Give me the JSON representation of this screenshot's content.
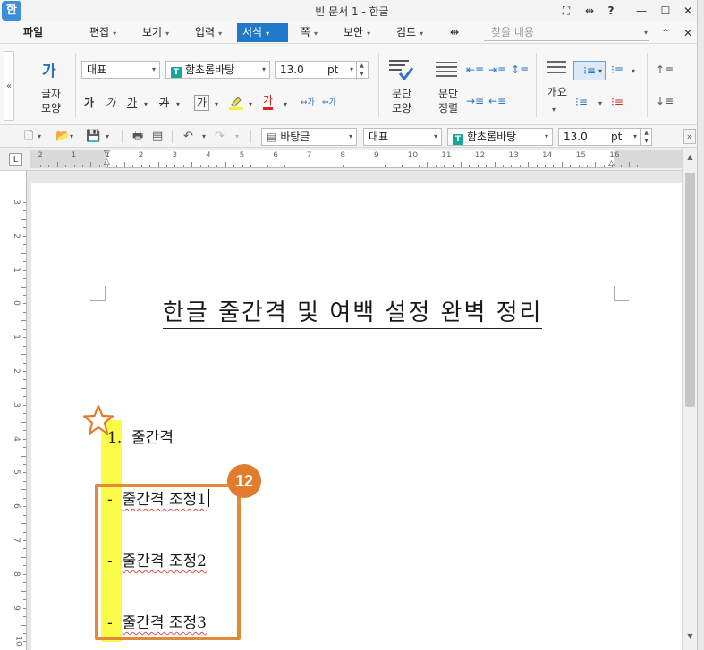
{
  "window": {
    "title": "빈 문서 1 - 한글",
    "app_icon": "한",
    "controls": [
      "⛶",
      "⇹",
      "?",
      "—",
      "☐",
      "✕"
    ]
  },
  "menu": {
    "items": [
      "파일",
      "편집",
      "보기",
      "입력",
      "서식",
      "쪽",
      "보안",
      "검토",
      "⇹"
    ],
    "active_index": 4,
    "search_placeholder": "찾을 내용",
    "collapse": "⌃",
    "close": "✕"
  },
  "ribbon": {
    "collapse_toggle": "«",
    "char_shape_label": "글자\n모양",
    "char_glyph": "가",
    "style_combo": "대표",
    "font_combo": "함초롬바탕",
    "font_glyph": "T",
    "size_value": "13.0",
    "size_unit": "pt",
    "format_buttons": [
      "가",
      "가",
      "가",
      "가",
      "가",
      "가",
      "가"
    ],
    "para_shape_label": "문단\n모양",
    "para_align_label": "문단\n정렬",
    "outline_label": "개요",
    "spin_up": "▲",
    "spin_down": "▼"
  },
  "toolbar2": {
    "style_combo": "바탕글",
    "lang_combo": "대표",
    "font_combo": "함초롬바탕",
    "size_value": "13.0",
    "size_unit": "pt",
    "expand": "»"
  },
  "ruler": {
    "corner": "L",
    "h_numbers": [
      "2",
      "1",
      "1",
      "2",
      "3",
      "4",
      "5",
      "6",
      "7",
      "8",
      "9",
      "10",
      "11",
      "12",
      "13",
      "14",
      "15",
      "16"
    ],
    "v_numbers": [
      "3",
      "2",
      "1",
      "0",
      "1",
      "2",
      "3",
      "4",
      "5",
      "6",
      "7",
      "8",
      "9",
      "10"
    ]
  },
  "document": {
    "title": "한글 줄간격 및 여백 설정 완벽 정리",
    "heading_number": "1.",
    "heading_text": "줄간격",
    "items": [
      {
        "bullet": "-",
        "text": "줄간격 조정1"
      },
      {
        "bullet": "-",
        "text": "줄간격 조정2"
      },
      {
        "bullet": "-",
        "text": "줄간격 조정3"
      }
    ]
  },
  "annotation": {
    "step_number": "12",
    "accent_color": "#e07c2c",
    "highlight_color": "#fbfb4a"
  }
}
